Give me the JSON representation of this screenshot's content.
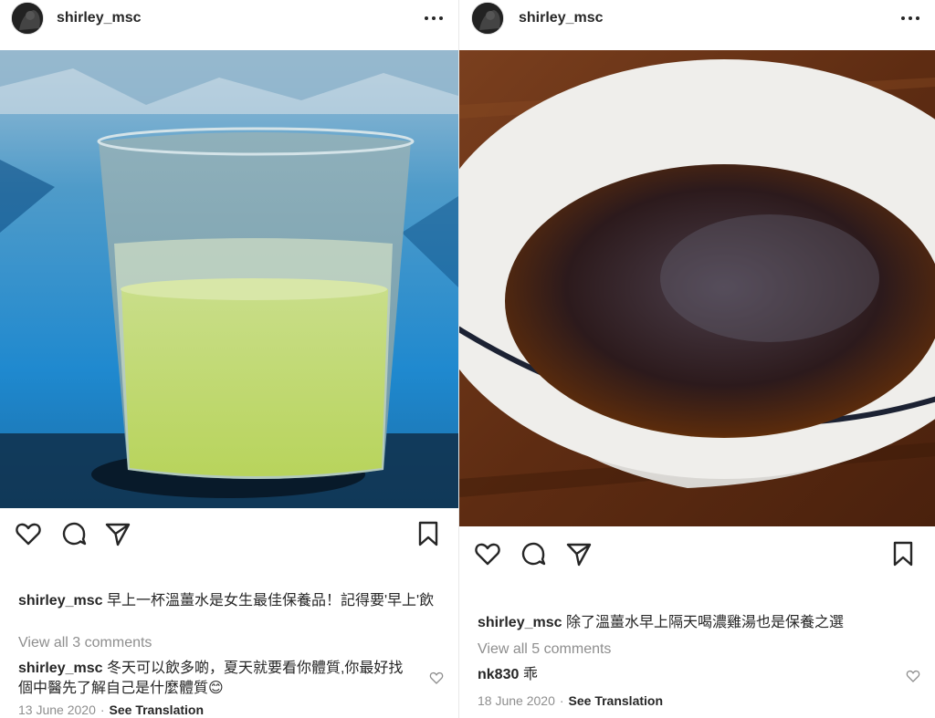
{
  "posts": [
    {
      "username": "shirley_msc",
      "caption_user": "shirley_msc",
      "caption_text": "早上一杯溫薑水是女生最佳保養品！記得要'早上'飲",
      "view_all": "View all 3 comments",
      "comment_user": "shirley_msc",
      "comment_text": "冬天可以飲多啲，夏天就要看你體質,你最好找個中醫先了解自己是什麼體質😊",
      "date": "13 June 2020",
      "separator": "·",
      "see_translation": "See Translation"
    },
    {
      "username": "shirley_msc",
      "caption_user": "shirley_msc",
      "caption_text": "除了溫薑水早上隔天喝濃雞湯也是保養之選",
      "view_all": "View all 5 comments",
      "comment_user": "nk830",
      "comment_text": "乖",
      "date": "18 June 2020",
      "separator": "·",
      "see_translation": "See Translation"
    }
  ],
  "icons": {
    "like": "heart-icon",
    "comment": "comment-icon",
    "share": "paper-plane-icon",
    "save": "bookmark-icon",
    "more": "more-options-icon"
  },
  "colors": {
    "text": "#262626",
    "muted": "#8e8e8e",
    "border": "#e8e8e8"
  }
}
